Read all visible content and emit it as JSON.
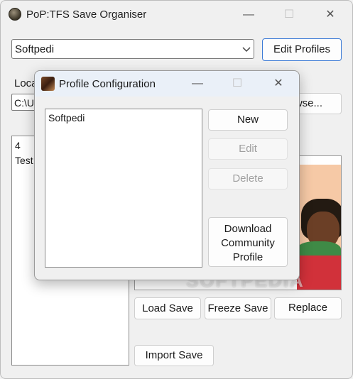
{
  "window": {
    "title": "PoP:TFS Save Organiser",
    "controls": {
      "minimize": "—",
      "maximize": "☐",
      "close": "✕"
    }
  },
  "profile_select": {
    "value": "Softpedi"
  },
  "edit_profiles_label": "Edit Profiles",
  "location": {
    "label_partial": "Loca",
    "path_partial": "C:\\Us",
    "browse_partial": "wse..."
  },
  "saves_list": {
    "items": [
      "4",
      "Test"
    ]
  },
  "actions": {
    "load_save": "Load Save",
    "freeze_save": "Freeze Save",
    "replace": "Replace",
    "import_save": "Import Save"
  },
  "watermark": "SOFTPEDIA",
  "dialog": {
    "title": "Profile Configuration",
    "profiles": [
      "Softpedi"
    ],
    "buttons": {
      "new": "New",
      "edit": "Edit",
      "delete": "Delete",
      "download_line1": "Download",
      "download_line2": "Community",
      "download_line3": "Profile"
    }
  }
}
